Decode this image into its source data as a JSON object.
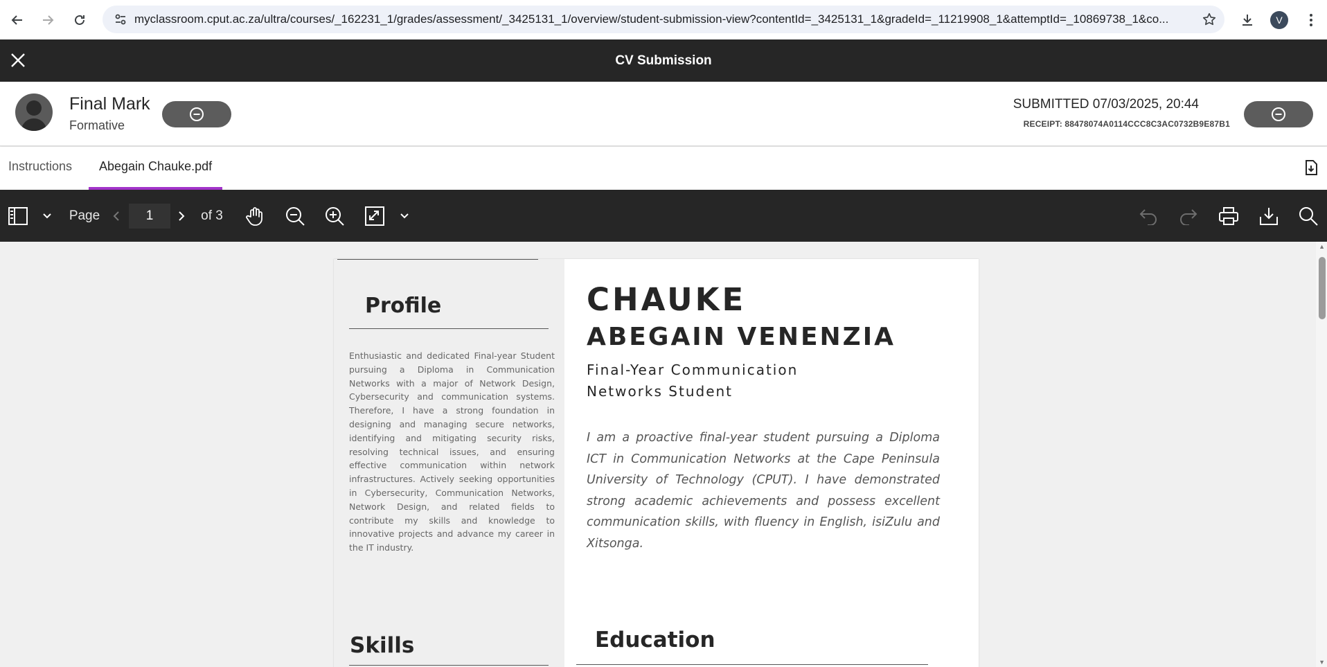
{
  "browser": {
    "url": "myclassroom.cput.ac.za/ultra/courses/_162231_1/grades/assessment/_3425131_1/overview/student-submission-view?contentId=_3425131_1&gradeId=_11219908_1&attemptId=_10869738_1&co...",
    "profile_initial": "V"
  },
  "header": {
    "title": "CV Submission"
  },
  "info": {
    "mark_title": "Final Mark",
    "mark_type": "Formative",
    "submitted": "SUBMITTED 07/03/2025, 20:44",
    "receipt": "RECEIPT: 88478074A0114CCC8C3AC0732B9E87B1"
  },
  "tabs": [
    {
      "label": "Instructions"
    },
    {
      "label": "Abegain Chauke.pdf"
    }
  ],
  "toolbar": {
    "page_label": "Page",
    "page_value": "1",
    "page_total": "of 3"
  },
  "document": {
    "sidebar": {
      "profile_heading": "Profile",
      "profile_text": "Enthusiastic and dedicated Final-year Student pursuing a Diploma in Communication Networks with a major of Network Design, Cybersecurity and communication systems. Therefore, I have a strong foundation in designing and managing secure networks, identifying and mitigating security risks, resolving technical issues, and ensuring effective communication within network infrastructures. Actively seeking opportunities in Cybersecurity, Communication Networks, Network Design, and related fields to contribute my skills and knowledge to innovative projects and advance my career in the IT industry.",
      "skills_heading": "Skills"
    },
    "main": {
      "last_name": "CHAUKE",
      "first_names": "ABEGAIN VENENZIA",
      "role": "Final-Year Communication Networks Student",
      "summary": "I am a proactive final-year student pursuing a Diploma ICT in Communication Networks at the Cape Peninsula University of Technology (CPUT). I have demonstrated strong academic achievements and possess excellent communication skills, with fluency in English, isiZulu and Xitsonga.",
      "education_heading": "Education"
    }
  },
  "colors": {
    "header_bg": "#262626",
    "tab_accent": "#a233c9",
    "pill_bg": "#5c5c5c"
  }
}
